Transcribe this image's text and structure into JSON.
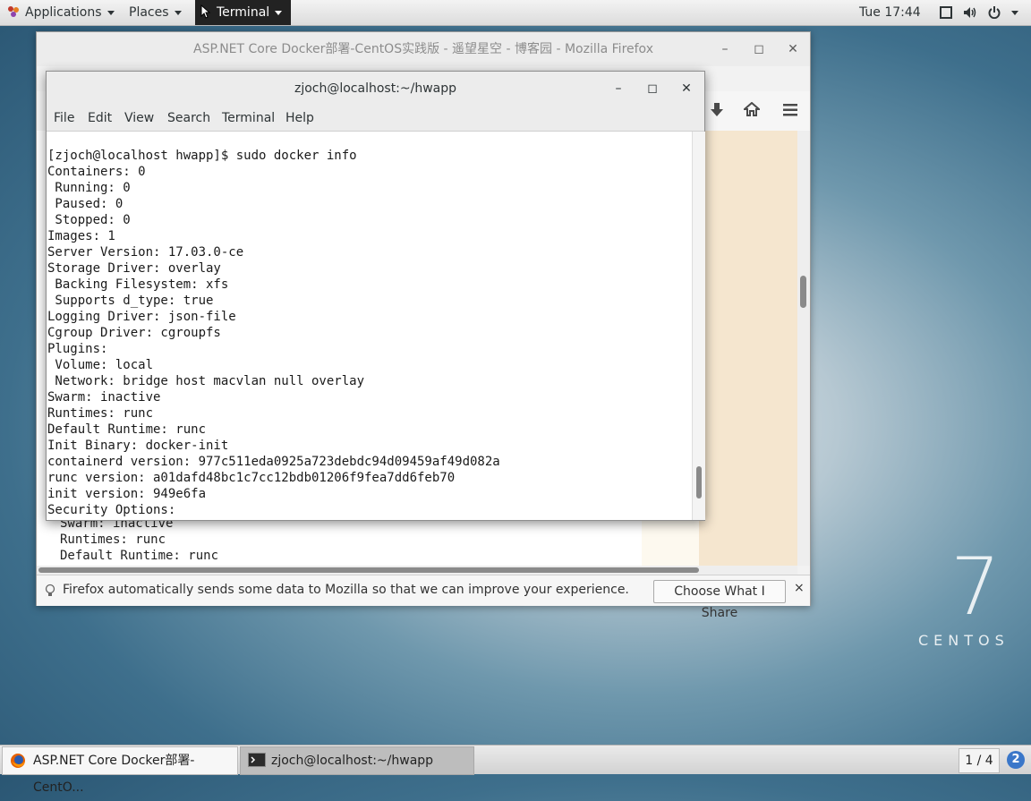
{
  "top_panel": {
    "applications": "Applications",
    "places": "Places",
    "terminal": "Terminal",
    "clock": "Tue 17:44"
  },
  "firefox": {
    "title": "ASP.NET Core Docker部署-CentOS实践版 - 遥望星空 - 博客园 - Mozilla Firefox",
    "background_lines": [
      "Swarm: inactive",
      "Runtimes: runc",
      "Default Runtime: runc"
    ],
    "notification_text": "Firefox automatically sends some data to Mozilla so that we can improve your experience.",
    "share_button": "Choose What I Share",
    "close_glyph": "×"
  },
  "terminal": {
    "title": "zjoch@localhost:~/hwapp",
    "menu": [
      "File",
      "Edit",
      "View",
      "Search",
      "Terminal",
      "Help"
    ],
    "lines": [
      "",
      "[zjoch@localhost hwapp]$ sudo docker info",
      "Containers: 0",
      " Running: 0",
      " Paused: 0",
      " Stopped: 0",
      "Images: 1",
      "Server Version: 17.03.0-ce",
      "Storage Driver: overlay",
      " Backing Filesystem: xfs",
      " Supports d_type: true",
      "Logging Driver: json-file",
      "Cgroup Driver: cgroupfs",
      "Plugins:",
      " Volume: local",
      " Network: bridge host macvlan null overlay",
      "Swarm: inactive",
      "Runtimes: runc",
      "Default Runtime: runc",
      "Init Binary: docker-init",
      "containerd version: 977c511eda0925a723debdc94d09459af49d082a",
      "runc version: a01dafd48bc1c7cc12bdb01206f9fea7dd6feb70",
      "init version: 949e6fa",
      "Security Options:"
    ]
  },
  "branding": {
    "number": "7",
    "word": "CENTOS"
  },
  "taskbar": {
    "firefox_task": "ASP.NET Core Docker部署-CentO...",
    "terminal_task": "zjoch@localhost:~/hwapp",
    "workspace": "1 / 4",
    "badge": "2"
  },
  "colors": {
    "panel_bg": "#dcdcdc",
    "terminal_text": "#1a1a1a",
    "firefox_beige": "#f5e6cf",
    "badge_blue": "#3a77c9"
  }
}
